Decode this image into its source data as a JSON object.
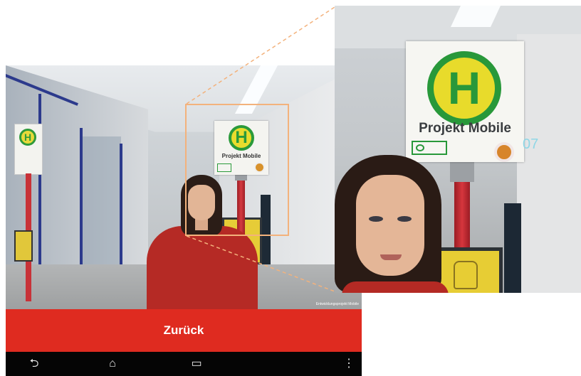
{
  "scene": {
    "sign_text": "Projekt Mobile",
    "sign_letter": "H",
    "watermark": "Entwicklungsprojekt Mobile"
  },
  "back_button": {
    "label": "Zurück"
  },
  "navbar": {
    "back_icon": "⮌",
    "home_icon": "⌂",
    "recents_icon": "▭",
    "menu_icon": "⋮"
  },
  "inset": {
    "sign_letter": "H",
    "sign_text": "Projekt Mobile",
    "stop_number": "07",
    "line_color": "#f3b27c"
  },
  "colors": {
    "accent_red": "#df2b20",
    "sign_green": "#28983a",
    "sign_yellow": "#e8db2b"
  }
}
